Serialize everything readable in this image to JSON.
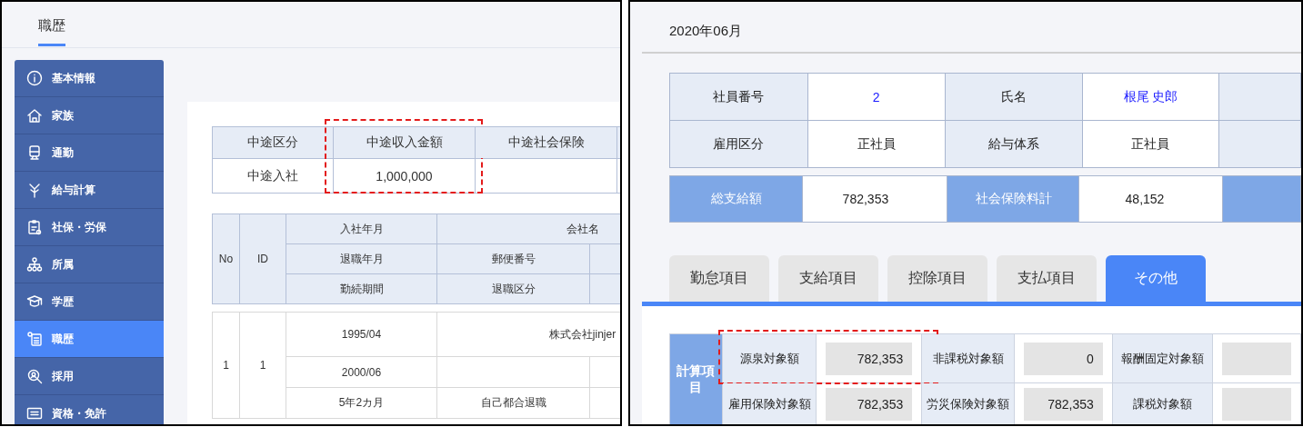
{
  "left_panel": {
    "tab": {
      "label": "職歴",
      "selected": true
    },
    "sidebar": {
      "items": [
        {
          "label": "基本情報",
          "selected": false
        },
        {
          "label": "家族",
          "selected": false
        },
        {
          "label": "通勤",
          "selected": false
        },
        {
          "label": "給与計算",
          "selected": false
        },
        {
          "label": "社保・労保",
          "selected": false
        },
        {
          "label": "所属",
          "selected": false
        },
        {
          "label": "学歴",
          "selected": false
        },
        {
          "label": "職歴",
          "selected": true
        },
        {
          "label": "採用",
          "selected": false
        },
        {
          "label": "資格・免許",
          "selected": false
        }
      ]
    },
    "midcareer_table": {
      "columns": [
        {
          "label": "中途区分",
          "highlighted": false
        },
        {
          "label": "中途収入金額",
          "highlighted": true
        },
        {
          "label": "中途社会保険",
          "highlighted": false
        }
      ],
      "rows": [
        {
          "cells": [
            "中途入社",
            "1,000,000"
          ]
        }
      ]
    },
    "history_table": {
      "header": {
        "no": "No",
        "id": "ID",
        "rows": [
          [
            "入社年月",
            "会社名"
          ],
          [
            "退職年月",
            "郵便番号"
          ],
          [
            "勤続期間",
            "退職区分"
          ]
        ]
      },
      "records": [
        {
          "no": "1",
          "id": "1",
          "lines": [
            [
              "1995/04",
              "株式会社jinjer"
            ],
            [
              "2000/06"
            ],
            [
              "5年2カ月",
              "自己都合退職"
            ]
          ]
        }
      ]
    }
  },
  "right_panel": {
    "period": "2020年06月",
    "employee_table": {
      "rows": [
        [
          {
            "label": "社員番号",
            "value": "2",
            "link": true
          },
          {
            "label": "氏名",
            "value": "根尾 史郎",
            "link": true
          }
        ],
        [
          {
            "label": "雇用区分",
            "value": "正社員",
            "link": false
          },
          {
            "label": "給与体系",
            "value": "正社員",
            "link": false
          }
        ]
      ]
    },
    "totals": [
      {
        "label": "総支給額",
        "value": "782,353"
      },
      {
        "label": "社会保険料計",
        "value": "48,152"
      }
    ],
    "tabs": [
      {
        "label": "勤怠項目",
        "selected": false
      },
      {
        "label": "支給項目",
        "selected": false
      },
      {
        "label": "控除項目",
        "selected": false
      },
      {
        "label": "支払項目",
        "selected": false
      },
      {
        "label": "その他",
        "selected": true
      }
    ],
    "calc_table": {
      "heading": "計算項目",
      "rows": [
        [
          {
            "label": "源泉対象額",
            "value": "782,353",
            "highlighted": true
          },
          {
            "label": "非課税対象額",
            "value": "0",
            "highlighted": false
          },
          {
            "label": "報酬固定対象額",
            "highlighted": false
          }
        ],
        [
          {
            "label": "雇用保険対象額",
            "value": "782,353",
            "highlighted": false
          },
          {
            "label": "労災保険対象額",
            "value": "782,353",
            "highlighted": false
          },
          {
            "label": "課税対象額",
            "highlighted": false
          }
        ]
      ]
    }
  }
}
